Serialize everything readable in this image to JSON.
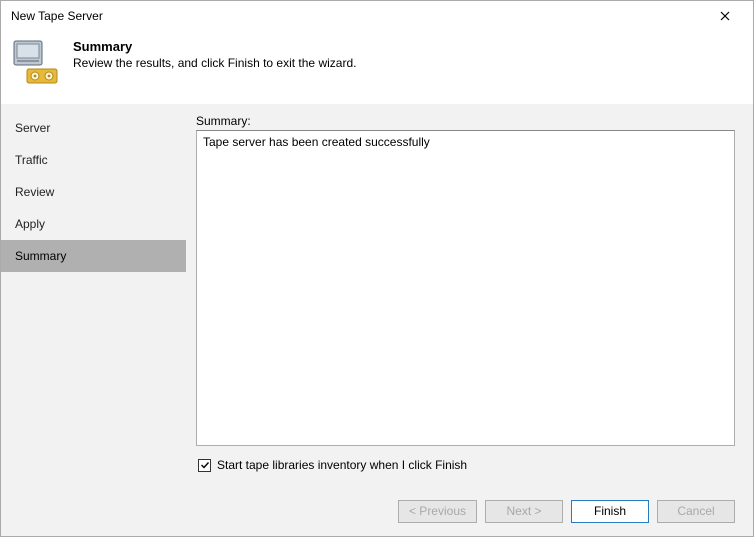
{
  "window": {
    "title": "New Tape Server"
  },
  "header": {
    "title": "Summary",
    "description": "Review the results, and click Finish to exit the wizard."
  },
  "sidebar": {
    "steps": [
      {
        "label": "Server",
        "active": false
      },
      {
        "label": "Traffic",
        "active": false
      },
      {
        "label": "Review",
        "active": false
      },
      {
        "label": "Apply",
        "active": false
      },
      {
        "label": "Summary",
        "active": true
      }
    ]
  },
  "main": {
    "summary_label": "Summary:",
    "summary_text": "Tape server has been created successfully",
    "checkbox_label": "Start tape libraries inventory when I click Finish",
    "checkbox_checked": true
  },
  "footer": {
    "previous": "< Previous",
    "next": "Next >",
    "finish": "Finish",
    "cancel": "Cancel"
  }
}
